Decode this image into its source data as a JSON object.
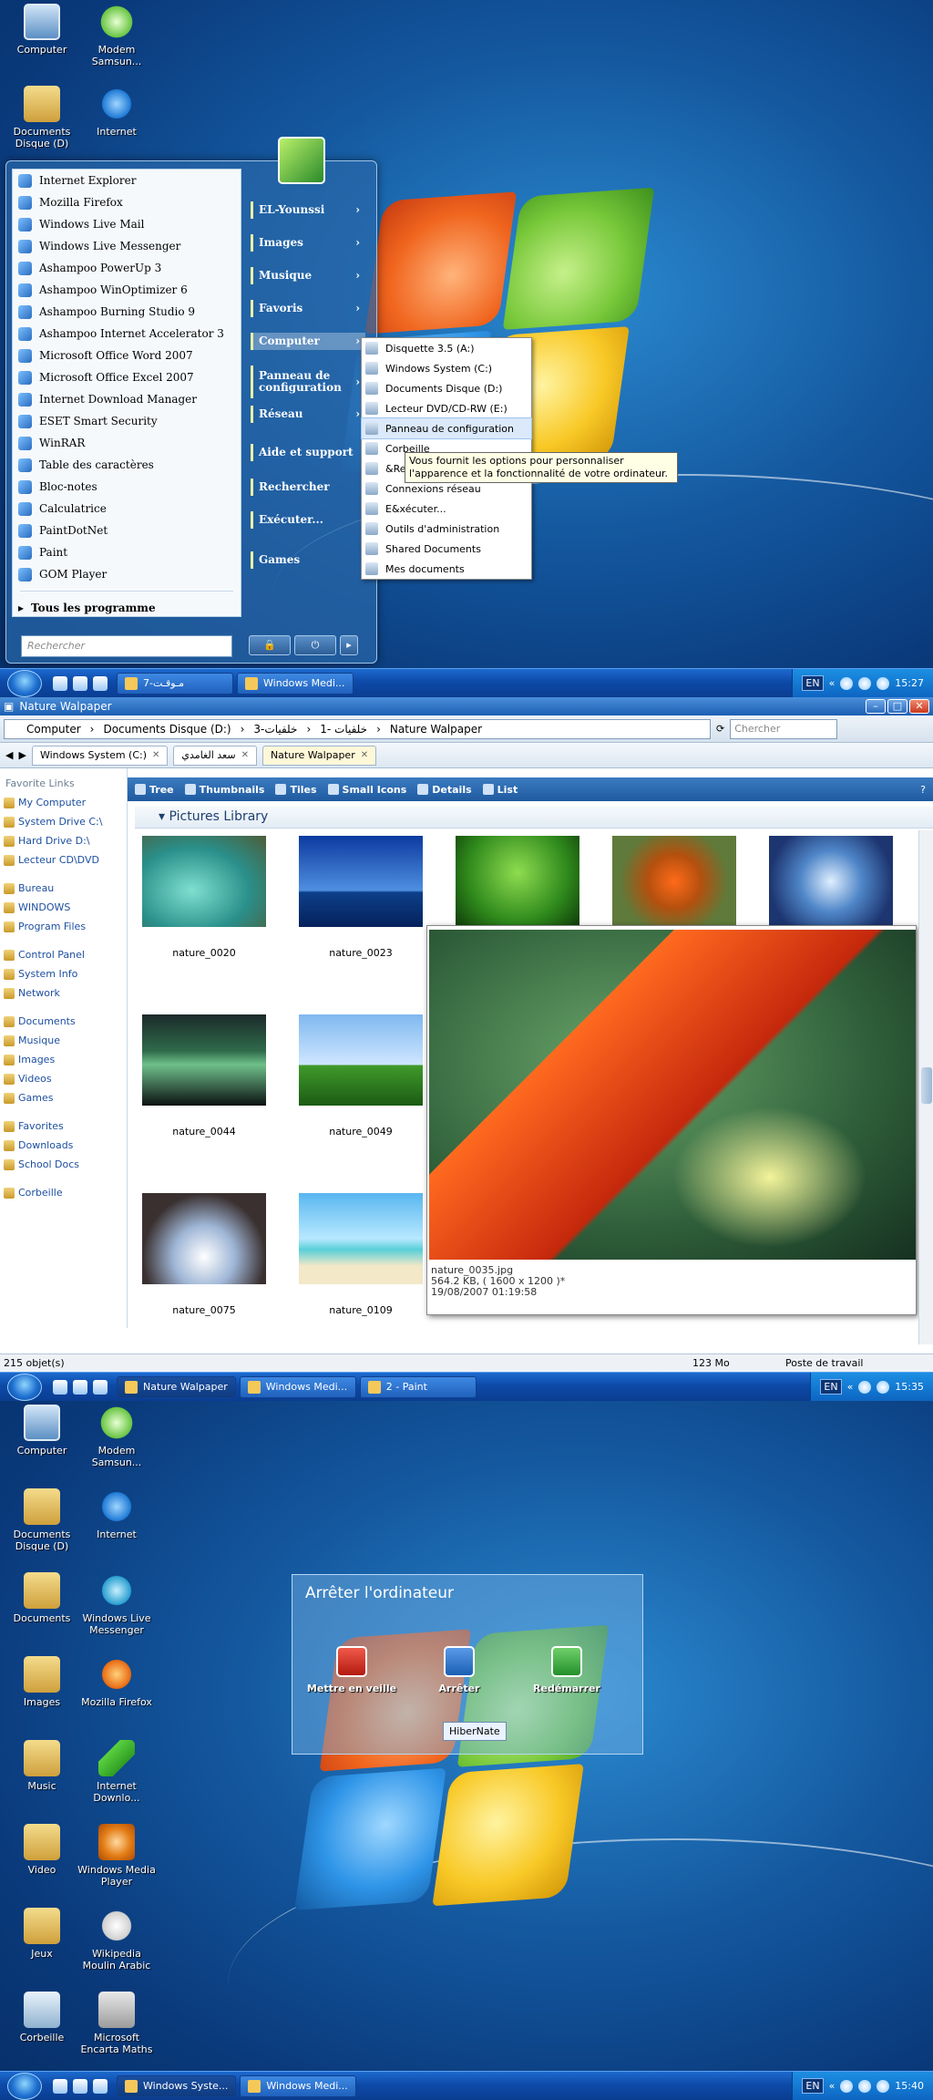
{
  "s1": {
    "desktop_icons": [
      {
        "label": "Computer",
        "icon": "computer-icon"
      },
      {
        "label": "Modem Samsun...",
        "icon": "modem-icon"
      },
      {
        "label": "Documents Disque (D)",
        "icon": "folder-icon"
      },
      {
        "label": "Internet",
        "icon": "internet-explorer-icon"
      }
    ],
    "start_menu": {
      "programs": [
        "Internet Explorer",
        "Mozilla Firefox",
        "Windows Live Mail",
        "Windows Live Messenger",
        "Ashampoo PowerUp 3",
        "Ashampoo WinOptimizer 6",
        "Ashampoo Burning Studio 9",
        "Ashampoo Internet Accelerator 3",
        "Microsoft Office Word 2007",
        "Microsoft Office Excel 2007",
        "Internet Download Manager",
        "ESET Smart Security",
        "WinRAR",
        "Table des caractères",
        "Bloc-notes",
        "Calculatrice",
        "PaintDotNet",
        "Paint",
        "GOM Player"
      ],
      "all_programs": "Tous les programme",
      "search_placeholder": "Rechercher",
      "right": [
        "EL-Younssi",
        "Images",
        "Musique",
        "Favoris",
        "Computer",
        "Panneau de configuration",
        "Réseau",
        "Aide et support",
        "Rechercher",
        "Exécuter...",
        "Games"
      ]
    },
    "submenu": [
      "Disquette 3.5 (A:)",
      "Windows System (C:)",
      "Documents Disque  (D:)",
      "Lecteur DVD/CD-RW (E:)",
      "Panneau de configuration",
      "Corbeille",
      "&Re",
      "Connexions réseau",
      "E&xécuter...",
      "Outils d'administration",
      "Shared Documents",
      "Mes documents"
    ],
    "tooltip": "Vous fournit les options pour personnaliser l'apparence et la fonctionnalité de votre ordinateur.",
    "taskbar": [
      "7-مـوقـت",
      "Windows Medi..."
    ],
    "tray": {
      "lang": "EN",
      "clock": "15:27"
    }
  },
  "s2": {
    "window_title": "Nature Walpaper",
    "address": [
      "Computer",
      "Documents Disque  (D:)",
      "3-خلفيات",
      "1- خلفيات",
      "Nature Walpaper"
    ],
    "search_placeholder": "Chercher",
    "tabs": [
      "Windows System (C:)",
      "سعد الغامدي",
      "Nature Walpaper"
    ],
    "toolbar": [
      "Tree",
      "Thumbnails",
      "Tiles",
      "Small Icons",
      "Details",
      "List"
    ],
    "favorites_title": "Favorite Links",
    "favorites": [
      [
        "My Computer",
        "System Drive C:\\",
        "Hard  Drive  D:\\",
        "Lecteur CD\\DVD"
      ],
      [
        "Bureau",
        "WINDOWS",
        "Program Files"
      ],
      [
        "Control Panel",
        "System Info",
        "Network"
      ],
      [
        "Documents",
        "Musique",
        "Images",
        "Videos",
        "Games"
      ],
      [
        "Favorites",
        "Downloads",
        "School Docs"
      ],
      [
        "Corbeille"
      ]
    ],
    "library_title": "Pictures Library",
    "thumbs": [
      "nature_0020",
      "nature_0023",
      "nature_0044",
      "nature_0049",
      "nature_0075",
      "nature_0109"
    ],
    "preview": {
      "name": "nature_0035.jpg",
      "info": "564.2 KB,   ( 1600 x 1200 )*",
      "date": "19/08/2007 01:19:58"
    },
    "status": {
      "count": "215 objet(s)",
      "size": "123 Mo",
      "location": "Poste de travail"
    },
    "taskbar": [
      "Nature Walpaper",
      "Windows Medi...",
      "2 - Paint"
    ],
    "tray": {
      "lang": "EN",
      "clock": "15:35"
    }
  },
  "s3": {
    "desktop_icons": [
      {
        "label": "Computer",
        "icon": "computer-icon"
      },
      {
        "label": "Modem Samsun...",
        "icon": "modem-icon"
      },
      {
        "label": "Documents Disque (D)",
        "icon": "folder-icon"
      },
      {
        "label": "Internet",
        "icon": "internet-explorer-icon"
      },
      {
        "label": "Documents",
        "icon": "documents-icon"
      },
      {
        "label": "Windows Live Messenger",
        "icon": "messenger-icon"
      },
      {
        "label": "Images",
        "icon": "images-icon"
      },
      {
        "label": "Mozilla Firefox",
        "icon": "firefox-icon"
      },
      {
        "label": "Music",
        "icon": "music-icon"
      },
      {
        "label": "Internet Downlo...",
        "icon": "download-manager-icon"
      },
      {
        "label": "Video",
        "icon": "video-icon"
      },
      {
        "label": "Windows Media Player",
        "icon": "media-player-icon"
      },
      {
        "label": "Jeux",
        "icon": "games-icon"
      },
      {
        "label": "Wikipedia Moulin Arabic",
        "icon": "wikipedia-icon"
      },
      {
        "label": "Corbeille",
        "icon": "recycle-bin-icon"
      },
      {
        "label": "Microsoft Encarta Maths",
        "icon": "calculator-icon"
      }
    ],
    "dialog": {
      "title": "Arrêter l'ordinateur",
      "buttons": [
        "Mettre en veille",
        "Arrêter",
        "Redémarrer"
      ],
      "tooltip": "HiberNate"
    },
    "taskbar": [
      "Windows Syste...",
      "Windows Medi..."
    ],
    "tray": {
      "lang": "EN",
      "clock": "15:40"
    }
  }
}
